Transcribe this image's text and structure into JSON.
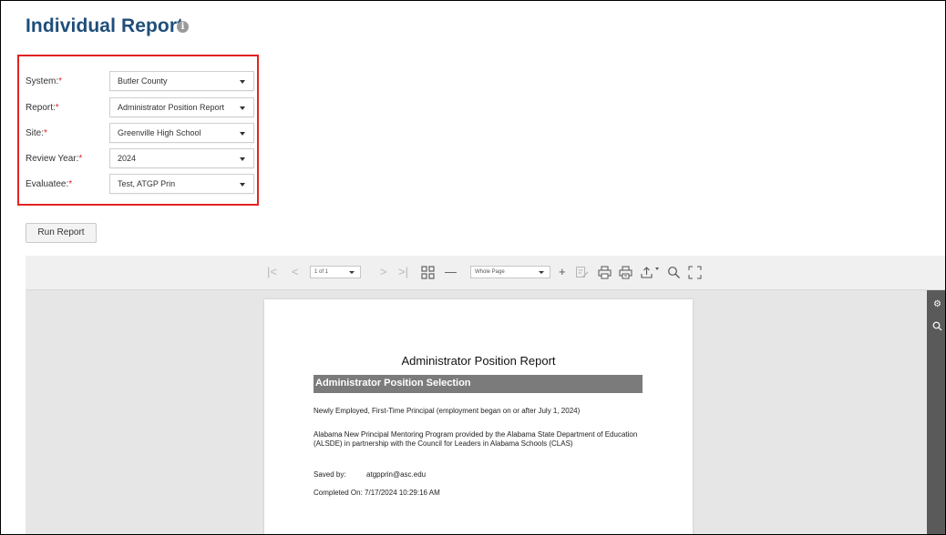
{
  "page": {
    "title": "Individual Report",
    "info_icon": "info-icon"
  },
  "filters": [
    {
      "label": "System:",
      "value": "Butler County"
    },
    {
      "label": "Report:",
      "value": "Administrator Position Report"
    },
    {
      "label": "Site:",
      "value": "Greenville High School"
    },
    {
      "label": "Review Year:",
      "value": "2024"
    },
    {
      "label": "Evaluatee:",
      "value": "Test, ATGP Prin"
    }
  ],
  "required_marker": "*",
  "run_button": "Run Report",
  "viewer": {
    "page_select": "1 of 1",
    "zoom_select": "Whole Page",
    "tools": {
      "first": "|<",
      "prev": "<",
      "next": ">",
      "last": ">|",
      "zoom_out": "—",
      "zoom_in": "+"
    },
    "side_icons": [
      "gear-icon",
      "search-icon"
    ]
  },
  "document": {
    "title": "Administrator Position Report",
    "section_header": "Administrator Position Selection",
    "selection_text": "Newly Employed, First-Time Principal (employment began on or after July 1, 2024)",
    "program_text": "Alabama New Principal Mentoring Program provided by the Alabama State Department of Education (ALSDE) in partnership with the Council for Leaders in Alabama Schools (CLAS)",
    "saved_by_label": "Saved by:",
    "saved_by_value": "atgpprin@asc.edu",
    "completed_label": "Completed On:",
    "completed_value": "7/17/2024 10:29:16 AM"
  }
}
